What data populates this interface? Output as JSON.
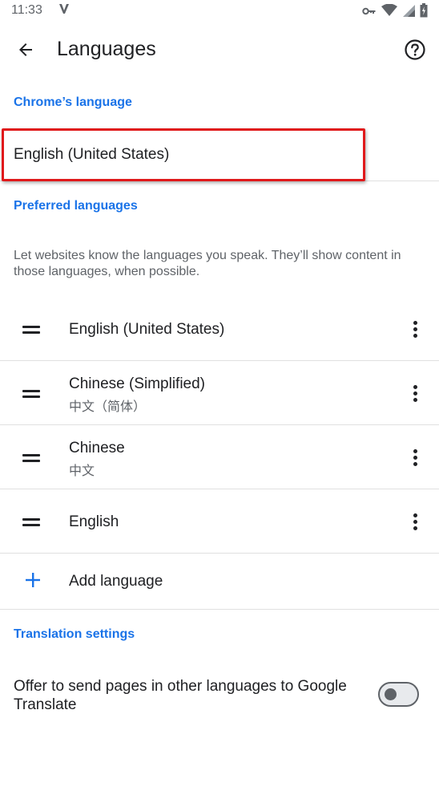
{
  "status_bar": {
    "time": "11:33",
    "icons": [
      "vpn-key-icon",
      "wifi-icon",
      "signal-icon",
      "battery-icon"
    ]
  },
  "app_bar": {
    "title": "Languages"
  },
  "chrome_language": {
    "header": "Chrome’s language",
    "value": "English (United States)"
  },
  "preferred_languages": {
    "header": "Preferred languages",
    "description": "Let websites know the languages you speak. They’ll show content in those languages, when possible.",
    "items": [
      {
        "name": "English (United States)",
        "native": ""
      },
      {
        "name": "Chinese (Simplified)",
        "native": "中文（简体）"
      },
      {
        "name": "Chinese",
        "native": "中文"
      },
      {
        "name": "English",
        "native": ""
      }
    ],
    "add_label": "Add language"
  },
  "translation_settings": {
    "header": "Translation settings",
    "offer_label": "Offer to send pages in other languages to Google Translate",
    "offer_enabled": false
  },
  "colors": {
    "accent": "#1a73e8",
    "highlight": "#e0191b"
  }
}
